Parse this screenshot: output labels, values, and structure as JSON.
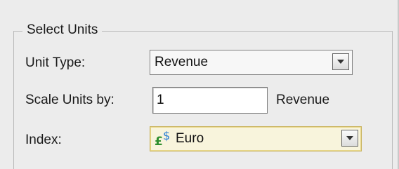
{
  "group": {
    "caption": "Select Units"
  },
  "unit_type": {
    "label": "Unit Type:",
    "selected": "Revenue"
  },
  "scale": {
    "label": "Scale Units by:",
    "value": "1",
    "unit_suffix": "Revenue"
  },
  "index": {
    "label": "Index:",
    "selected": "Euro",
    "icon": "currency-pound-dollar-icon"
  },
  "colors": {
    "panel_bg": "#ececec",
    "index_highlight_bg": "#f8f4dc",
    "pound_icon": "#2f8f2f",
    "dollar_icon": "#2b7fd6"
  }
}
